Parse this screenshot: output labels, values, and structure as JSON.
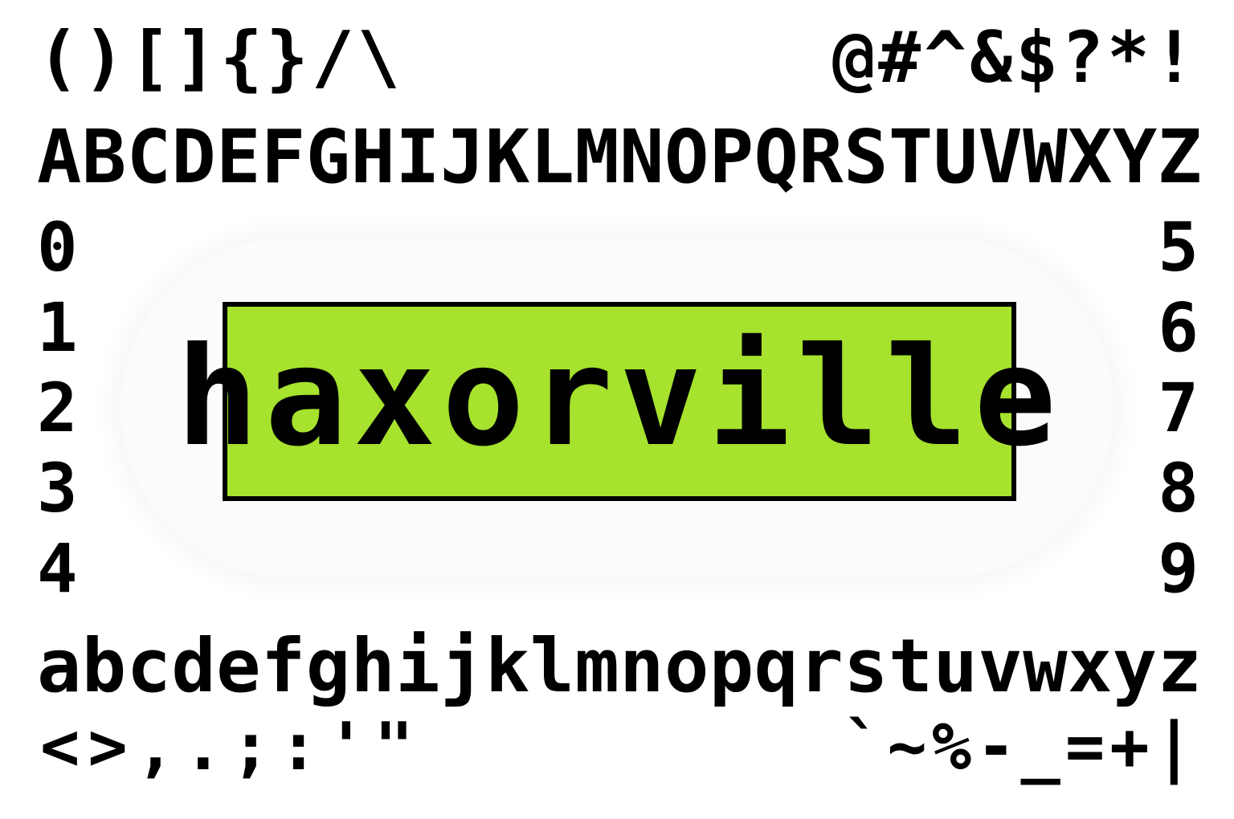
{
  "colors": {
    "background": "#ffffff",
    "glyph": "#000000",
    "logo_fill": "#a6e22e",
    "logo_border": "#000000"
  },
  "punctuation_top_left": "()[]{}/\\",
  "punctuation_top_right": "@#^&$?*!",
  "uppercase": [
    "A",
    "B",
    "C",
    "D",
    "E",
    "F",
    "G",
    "H",
    "I",
    "J",
    "K",
    "L",
    "M",
    "N",
    "O",
    "P",
    "Q",
    "R",
    "S",
    "T",
    "U",
    "V",
    "W",
    "X",
    "Y",
    "Z"
  ],
  "digits_left": [
    "0",
    "1",
    "2",
    "3",
    "4"
  ],
  "digits_right": [
    "5",
    "6",
    "7",
    "8",
    "9"
  ],
  "logo": {
    "text": "haxorville"
  },
  "lowercase": [
    "a",
    "b",
    "c",
    "d",
    "e",
    "f",
    "g",
    "h",
    "i",
    "j",
    "k",
    "l",
    "m",
    "n",
    "o",
    "p",
    "q",
    "r",
    "s",
    "t",
    "u",
    "v",
    "w",
    "x",
    "y",
    "z"
  ],
  "symbols_bottom_left": "<>,.;:'\"",
  "symbols_bottom_right": "`~%-_=+|"
}
